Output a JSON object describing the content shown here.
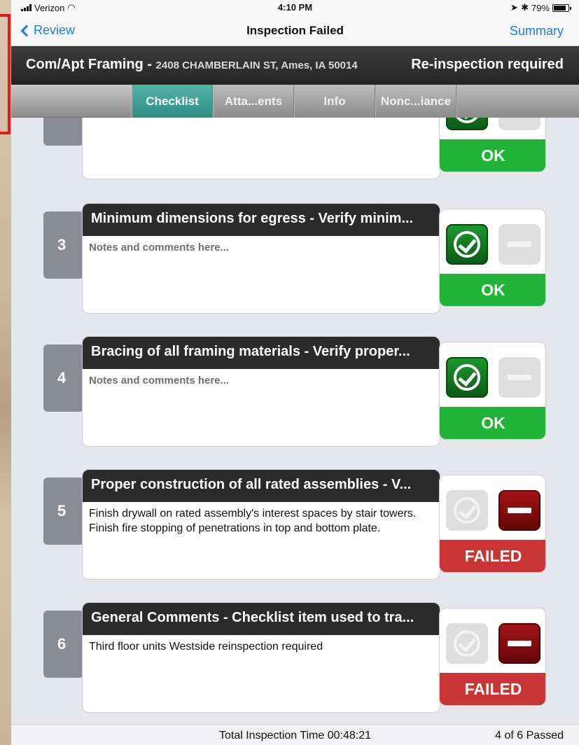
{
  "status_bar": {
    "carrier": "Verizon",
    "time": "4:10 PM",
    "battery": "79%"
  },
  "nav": {
    "back_label": "Review",
    "title": "Inspection Failed",
    "summary_label": "Summary"
  },
  "header": {
    "permit_type": "Com/Apt Framing - ",
    "address": "2408 CHAMBERLAIN ST, Ames, IA 50014",
    "status": "Re-inspection required"
  },
  "tabs": [
    {
      "label": "Checklist",
      "active": true
    },
    {
      "label": "Atta...ents",
      "active": false
    },
    {
      "label": "Info",
      "active": false
    },
    {
      "label": "Nonc...iance",
      "active": false
    }
  ],
  "items": [
    {
      "number": "",
      "title": "",
      "notes": "",
      "result": "ok",
      "result_label": "OK"
    },
    {
      "number": "3",
      "title": "Minimum dimensions for egress - Verify minim...",
      "notes": "Notes and comments here...",
      "placeholder": true,
      "result": "ok",
      "result_label": "OK"
    },
    {
      "number": "4",
      "title": "Bracing of all framing materials - Verify proper...",
      "notes": "Notes and comments here...",
      "placeholder": true,
      "result": "ok",
      "result_label": "OK"
    },
    {
      "number": "5",
      "title": "Proper construction of all rated assemblies - V...",
      "notes": "Finish drywall on rated assembly's interest spaces by stair towers. Finish fire stopping of penetrations in top and bottom plate.",
      "placeholder": false,
      "result": "failed",
      "result_label": "FAILED"
    },
    {
      "number": "6",
      "title": "General Comments - Checklist item used to tra...",
      "notes": "Third floor units Westside reinspection required",
      "placeholder": false,
      "result": "failed",
      "result_label": "FAILED"
    }
  ],
  "footer": {
    "total_time": "Total Inspection Time 00:48:21",
    "passed": "4 of 6 Passed"
  },
  "colors": {
    "accent": "#1a7cf4",
    "ok": "#20b338",
    "failed": "#c93434",
    "tab_active": "#3a9f95"
  }
}
